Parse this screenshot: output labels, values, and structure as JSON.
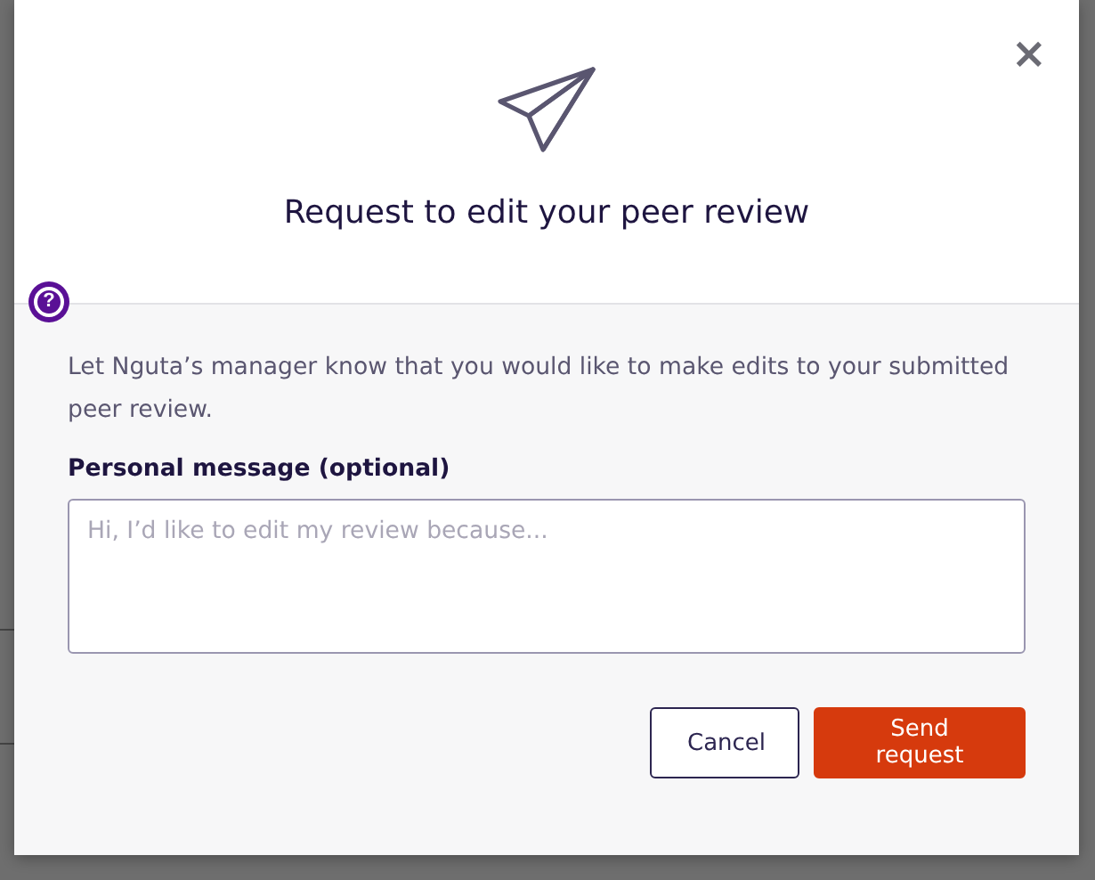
{
  "dialog": {
    "title": "Request to edit your peer review",
    "close": "×",
    "description": "Let Nguta’s manager know that you would like to make edits to your submitted peer review.",
    "message_label": "Personal message (optional)",
    "message_field": {
      "placeholder": "Hi, I’d like to edit my review because..."
    },
    "buttons": [
      {
        "label": "Cancel",
        "kind": "secondary"
      },
      {
        "label": "Send request",
        "kind": "primary"
      }
    ]
  },
  "help": {
    "label": "?"
  }
}
